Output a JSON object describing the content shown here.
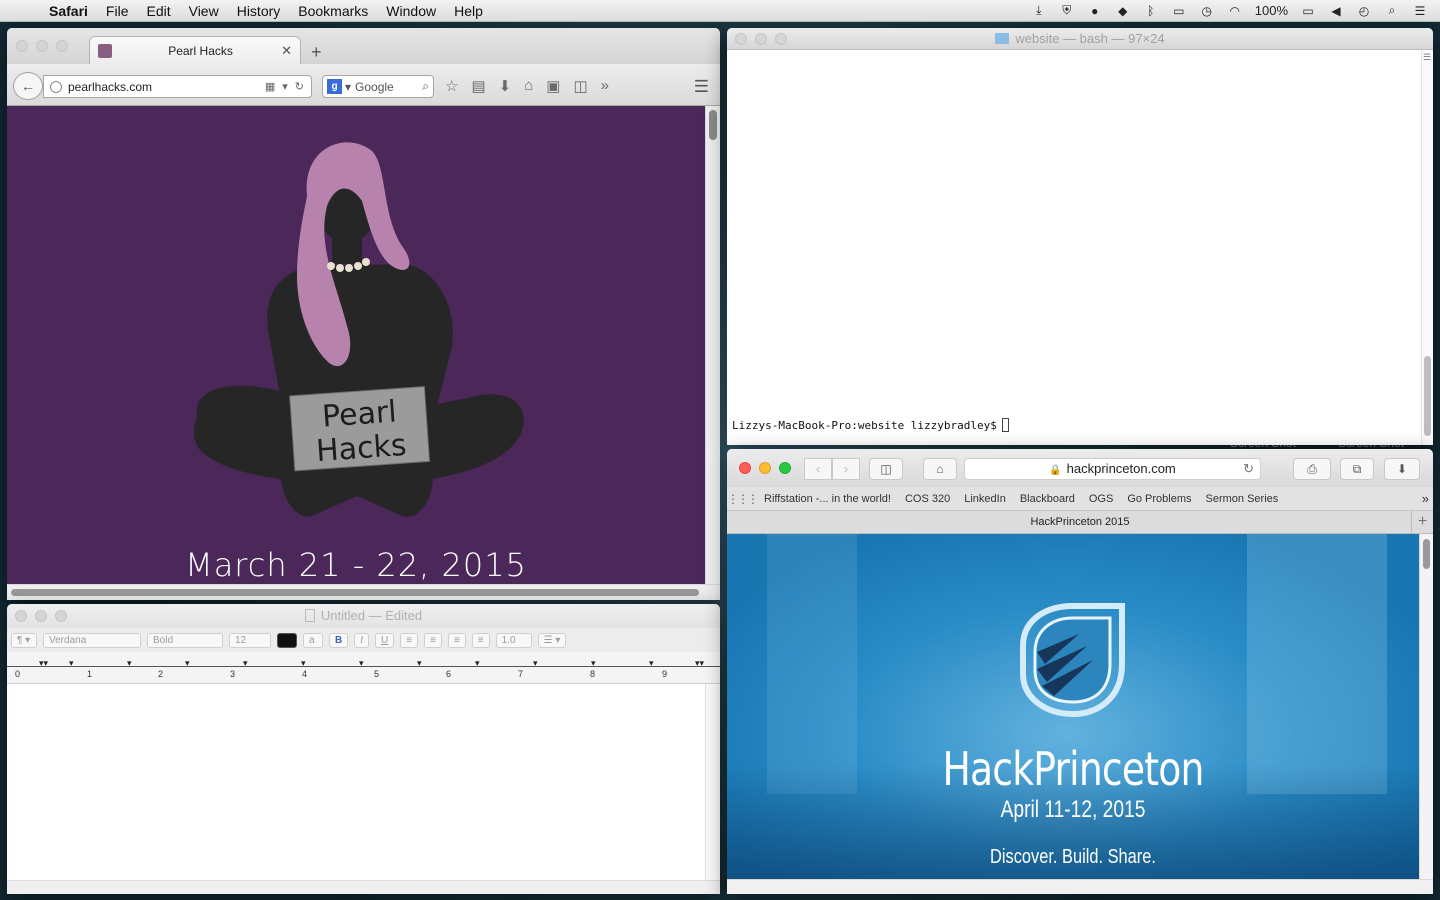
{
  "menubar": {
    "apple_icon": "apple-logo-icon",
    "items": [
      "Safari",
      "File",
      "Edit",
      "View",
      "History",
      "Bookmarks",
      "Window",
      "Help"
    ],
    "battery": "100%"
  },
  "desktop": {
    "file_labels": [
      "Screen Shot",
      "Screen Shot"
    ]
  },
  "firefox": {
    "tab_title": "Pearl Hacks",
    "url": "pearlhacks.com",
    "search_engine": "Google",
    "page": {
      "sign_line1": "Pearl",
      "sign_line2": "Hacks",
      "date": "March 21 - 22, 2015",
      "bg_color": "#4b275a"
    }
  },
  "terminal": {
    "title": "website — bash — 97×24",
    "prompt": "Lizzys-MacBook-Pro:website lizzybradley$"
  },
  "textedit": {
    "title": "Untitled",
    "title_status": "Edited",
    "paragraph_style": "¶",
    "font": "Verdana",
    "weight": "Bold",
    "size": "12",
    "bold": "B",
    "italic": "I",
    "underline": "U",
    "spacing": "1.0",
    "ruler_numbers": [
      "0",
      "1",
      "2",
      "3",
      "4",
      "5",
      "6",
      "7",
      "8",
      "9"
    ]
  },
  "safari": {
    "url": "hackprinceton.com",
    "bookmarks": [
      "Riffstation -... in the world!",
      "COS 320",
      "LinkedIn",
      "Blackboard",
      "OGS",
      "Go Problems",
      "Sermon Series"
    ],
    "tab_title": "HackPrinceton 2015",
    "page": {
      "title": "HackPrinceton",
      "date": "April 11-12, 2015",
      "tagline": "Discover. Build. Share."
    }
  }
}
